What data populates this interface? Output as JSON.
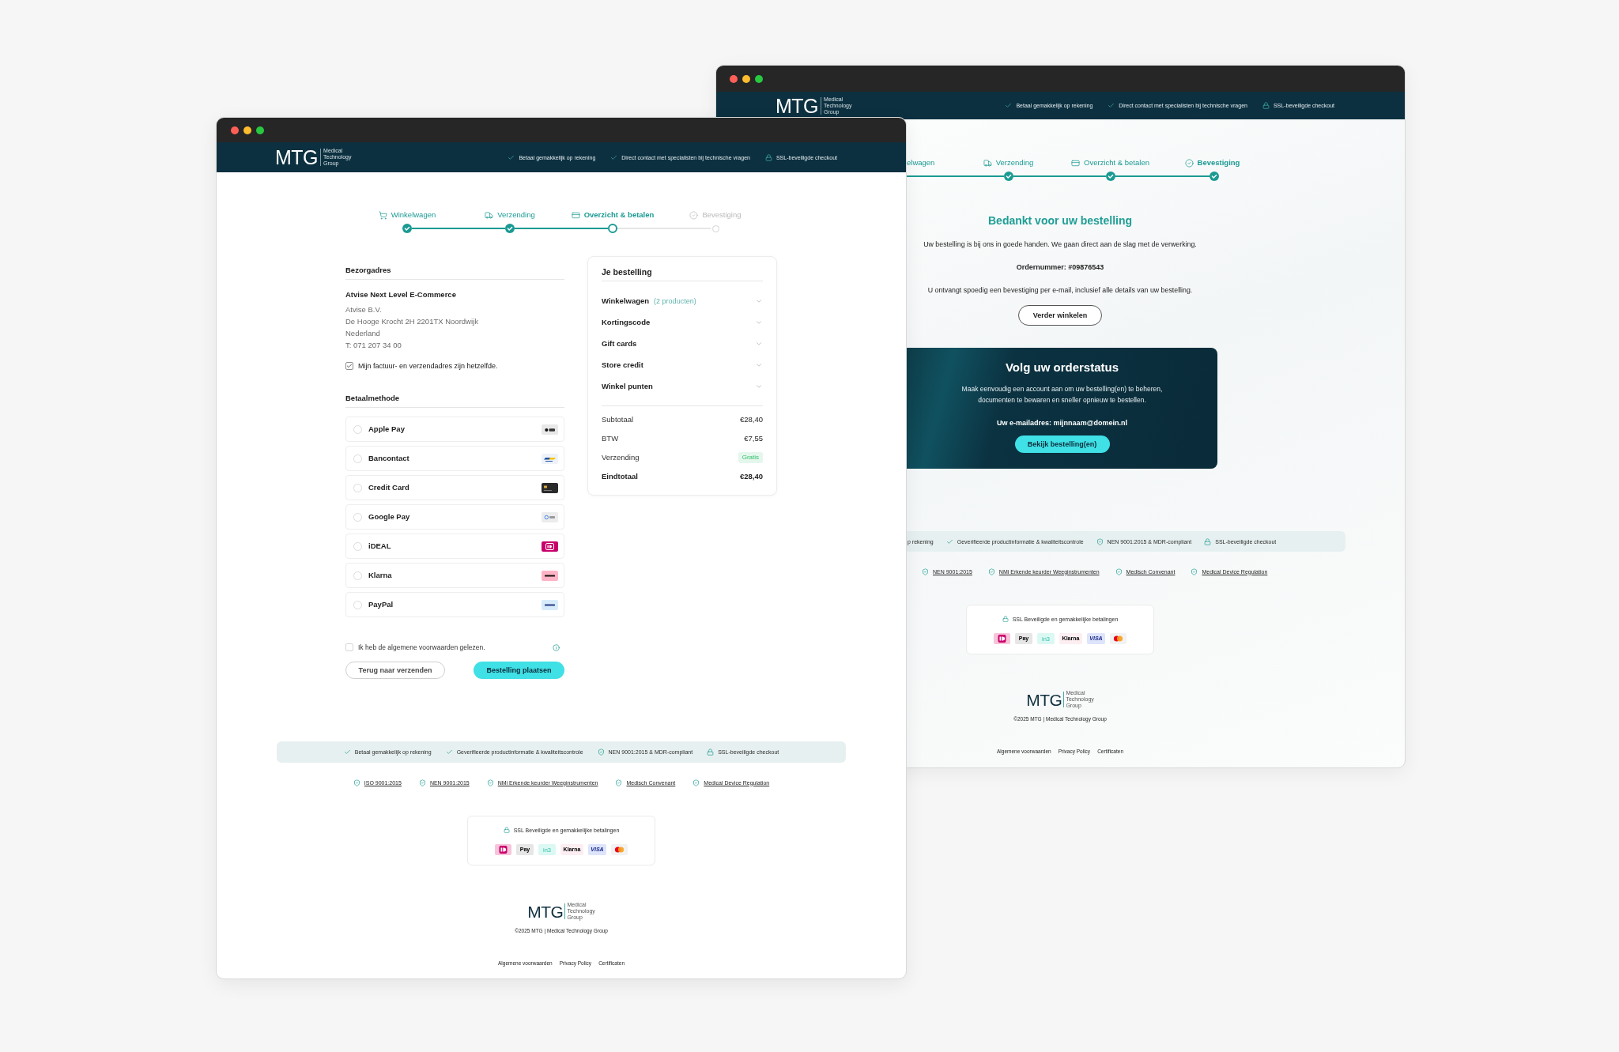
{
  "front_window": {
    "header": {
      "logo": {
        "mark": "MTG",
        "tagline": "Medical Technology Group"
      },
      "usps": [
        {
          "kind": "check",
          "text": "Betaal gemakkelijk op rekening"
        },
        {
          "kind": "check",
          "text": "Direct contact met specialisten bij technische vragen"
        },
        {
          "kind": "lock",
          "text": "SSL-beveiligde checkout"
        }
      ]
    },
    "steps": [
      {
        "label": "Winkelwagen",
        "done": true,
        "selected": false
      },
      {
        "label": "Verzending",
        "done": true,
        "selected": false
      },
      {
        "label": "Overzicht & betalen",
        "done": false,
        "selected": true
      },
      {
        "label": "Bevestiging",
        "done": false,
        "selected": false
      }
    ],
    "address": {
      "title": "Bezorgadres",
      "name": "Atvise Next Level E-Commerce",
      "lines": [
        "Atvise B.V.",
        "De Hooge Krocht 2H 2201TX Noordwijk",
        "Nederland",
        "T: 071 207 34 00"
      ],
      "same_address": {
        "label": "Mijn factuur- en verzendadres zijn hetzelfde.",
        "checked": true
      }
    },
    "payment": {
      "title": "Betaalmethode",
      "methods": [
        {
          "label": "Apple Pay",
          "kind": "applepay",
          "selected": false
        },
        {
          "label": "Bancontact",
          "kind": "bancontact",
          "selected": false
        },
        {
          "label": "Credit Card",
          "kind": "creditcard",
          "selected": false
        },
        {
          "label": "Google Pay",
          "kind": "googlepay",
          "selected": false
        },
        {
          "label": "iDEAL",
          "kind": "ideal",
          "selected": false
        },
        {
          "label": "Klarna",
          "kind": "klarna",
          "selected": false
        },
        {
          "label": "PayPal",
          "kind": "paypal",
          "selected": false
        }
      ]
    },
    "terms": {
      "label": "Ik heb de algemene voorwaarden gelezen.",
      "checked": false
    },
    "buttons": {
      "back": "Terug naar verzenden",
      "submit": "Bestelling plaatsen"
    },
    "order": {
      "title": "Je bestelling",
      "sections": [
        {
          "label": "Winkelwagen",
          "note": "(2 producten)",
          "expanded": false
        },
        {
          "label": "Kortingscode",
          "expanded": false
        },
        {
          "label": "Gift cards",
          "expanded": false
        },
        {
          "label": "Store credit",
          "expanded": false
        },
        {
          "label": "Winkel punten",
          "expanded": false
        }
      ],
      "totals": [
        {
          "kind": "amount",
          "label": "Subtotaal",
          "value": "€28,40"
        },
        {
          "kind": "amount",
          "label": "BTW",
          "value": "€7,55"
        },
        {
          "kind": "badge",
          "label": "Verzending",
          "value": "Gratis"
        },
        {
          "kind": "total",
          "label": "Eindtotaal",
          "value": "€28,40"
        }
      ]
    },
    "trust_bar": [
      {
        "kind": "check",
        "text": "Betaal gemakkelijk op rekening"
      },
      {
        "kind": "check",
        "text": "Geverifieerde productinformatie & kwaliteitscontrole"
      },
      {
        "kind": "shield",
        "text": "NEN 9001:2015 & MDR-compliant"
      },
      {
        "kind": "lock",
        "text": "SSL-beveiligde checkout"
      }
    ],
    "certifications": [
      "ISO 9001:2015",
      "NEN 9001:2015",
      "NMi Erkende keurder Weeginstrumenten",
      "Medisch Convenant",
      "Medical Device Regulation"
    ],
    "payment_box": {
      "title": "SSL Beveiligde en gemakkelijke betalingen",
      "logos": [
        {
          "kind": "ideal"
        },
        {
          "kind": "applepay",
          "text": "Pay"
        },
        {
          "kind": "in3",
          "text": "in3"
        },
        {
          "kind": "klarna",
          "text": "Klarna"
        },
        {
          "kind": "visa",
          "text": "VISA"
        },
        {
          "kind": "mastercard"
        }
      ]
    },
    "footer": {
      "logo": {
        "mark": "MTG",
        "tagline": "Medical Technology Group"
      },
      "copyright": "©2025 MTG | Medical Technology Group",
      "links": [
        "Algemene voorwaarden",
        "Privacy Policy",
        "Certificaten"
      ]
    }
  },
  "back_window": {
    "header": {
      "logo": {
        "mark": "MTG",
        "tagline": "Medical Technology Group"
      },
      "usps": [
        {
          "kind": "check",
          "text": "Betaal gemakkelijk op rekening"
        },
        {
          "kind": "check",
          "text": "Direct contact met specialisten bij technische vragen"
        },
        {
          "kind": "lock",
          "text": "SSL-beveiligde checkout"
        }
      ]
    },
    "steps": [
      {
        "label": "elwagen",
        "done": true,
        "selected": false
      },
      {
        "label": "Verzending",
        "done": true,
        "selected": false
      },
      {
        "label": "Overzicht & betalen",
        "done": true,
        "selected": false
      },
      {
        "label": "Bevestiging",
        "done": true,
        "selected": true
      }
    ],
    "confirmation": {
      "title": "Bedankt voor uw bestelling",
      "message": "Uw bestelling is bij ons in goede handen. We gaan direct aan de slag met de verwerking.",
      "order_number": "Ordernummer: #09876543",
      "notice": "U ontvangt spoedig een bevestiging per e-mail, inclusief alle details van uw bestelling.",
      "button": "Verder winkelen"
    },
    "order_status": {
      "title": "Volg uw orderstatus",
      "text": "Maak eenvoudig een account aan om uw bestelling(en) te beheren, documenten te bewaren en sneller opnieuw te bestellen.",
      "email": "Uw e-mailadres: mijnnaam@domein.nl",
      "button": "Bekijk bestelling(en)"
    },
    "trust_bar": [
      {
        "text": "p rekening"
      },
      {
        "kind": "check",
        "text": "Geverifieerde productinformatie & kwaliteitscontrole"
      },
      {
        "kind": "shield",
        "text": "NEN 9001:2015 & MDR-compliant"
      },
      {
        "kind": "lock",
        "text": "SSL-beveiligde checkout"
      }
    ],
    "certifications": [
      "NEN 9001:2015",
      "NMi Erkende keurder Weeginstrumenten",
      "Medisch Convenant",
      "Medical Device Regulation"
    ],
    "payment_box": {
      "title": "SSL Beveiligde en gemakkelijke betalingen",
      "logos": [
        {
          "kind": "ideal"
        },
        {
          "kind": "applepay",
          "text": "Pay"
        },
        {
          "kind": "in3",
          "text": "in3"
        },
        {
          "kind": "klarna",
          "text": "Klarna"
        },
        {
          "kind": "visa",
          "text": "VISA"
        },
        {
          "kind": "mastercard"
        }
      ]
    },
    "footer": {
      "logo": {
        "mark": "MTG",
        "tagline": "Medical Technology Group"
      },
      "copyright": "©2025 MTG | Medical Technology Group",
      "links": [
        "Algemene voorwaarden",
        "Privacy Policy",
        "Certificaten"
      ]
    }
  }
}
